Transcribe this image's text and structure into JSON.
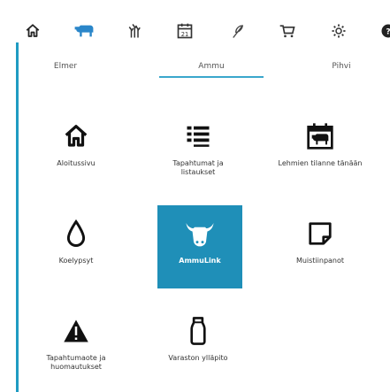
{
  "toolbar": {
    "icons": [
      "home-icon",
      "cow-icon",
      "crop-icon",
      "calendar-icon",
      "feather-icon",
      "cart-icon",
      "gear-icon",
      "help-icon"
    ],
    "active": "cow-icon",
    "calendar_day": "21"
  },
  "subtabs": {
    "items": [
      {
        "label": "Elmer"
      },
      {
        "label": "Ammu"
      },
      {
        "label": "Pihvi"
      }
    ],
    "active": "Ammu"
  },
  "tiles": [
    {
      "label": "Aloitussivu",
      "icon": "home-icon"
    },
    {
      "label": "Tapahtumat ja listaukset",
      "icon": "list-icon"
    },
    {
      "label": "Lehmien tilanne tänään",
      "icon": "cow-calendar-icon"
    },
    {
      "label": "Koelypsyt",
      "icon": "droplet-icon"
    },
    {
      "label": "AmmuLink",
      "icon": "cow-head-icon"
    },
    {
      "label": "Muistiinpanot",
      "icon": "note-icon"
    },
    {
      "label": "Tapahtumaote ja huomautukset",
      "icon": "warning-icon"
    },
    {
      "label": "Varaston ylläpito",
      "icon": "milk-can-icon"
    }
  ],
  "active_tile": "AmmuLink",
  "colors": {
    "accent": "#1f8fb8",
    "rail": "#1f9bc2",
    "active_icon": "#2a86c9"
  }
}
